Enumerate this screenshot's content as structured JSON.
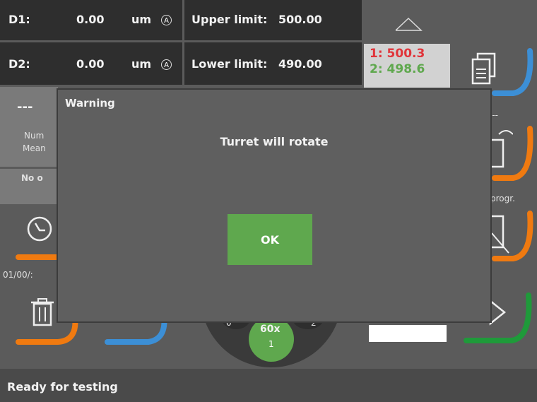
{
  "header": {
    "d1": {
      "label": "D1:",
      "value": "0.00",
      "unit": "um",
      "mode": "A"
    },
    "d2": {
      "label": "D2:",
      "value": "0.00",
      "unit": "um",
      "mode": "A"
    },
    "upper": {
      "label": "Upper limit:",
      "value": "500.00"
    },
    "lower": {
      "label": "Lower limit:",
      "value": "490.00"
    },
    "readings": {
      "r1": "1: 500.3",
      "r2": "2: 498.6",
      "r1_color": "#e0343a",
      "r2_color": "#5fa84e"
    }
  },
  "left_panel": {
    "dashes": "---",
    "num_label": "Num",
    "mean_label": "Mean",
    "no_label": "No o",
    "date_text": "01/00/:"
  },
  "right_panel": {
    "dash_text": "---",
    "progr_text": "progr."
  },
  "turret": {
    "label": "60x",
    "position": "1",
    "left_num": "0",
    "right_num": "2"
  },
  "dialog": {
    "title": "Warning",
    "message": "Turret will rotate",
    "ok_label": "OK"
  },
  "status": {
    "text": "Ready for testing"
  },
  "colors": {
    "orange": "#f07a10",
    "blue": "#3c8fd6",
    "green": "#1f9a3a",
    "ok_green": "#5fa84e"
  },
  "icons": [
    "chevron-up-icon",
    "document-icon",
    "document-undo-icon",
    "document-edit-icon",
    "arrow-right-icon",
    "clock-icon",
    "trash-icon"
  ]
}
